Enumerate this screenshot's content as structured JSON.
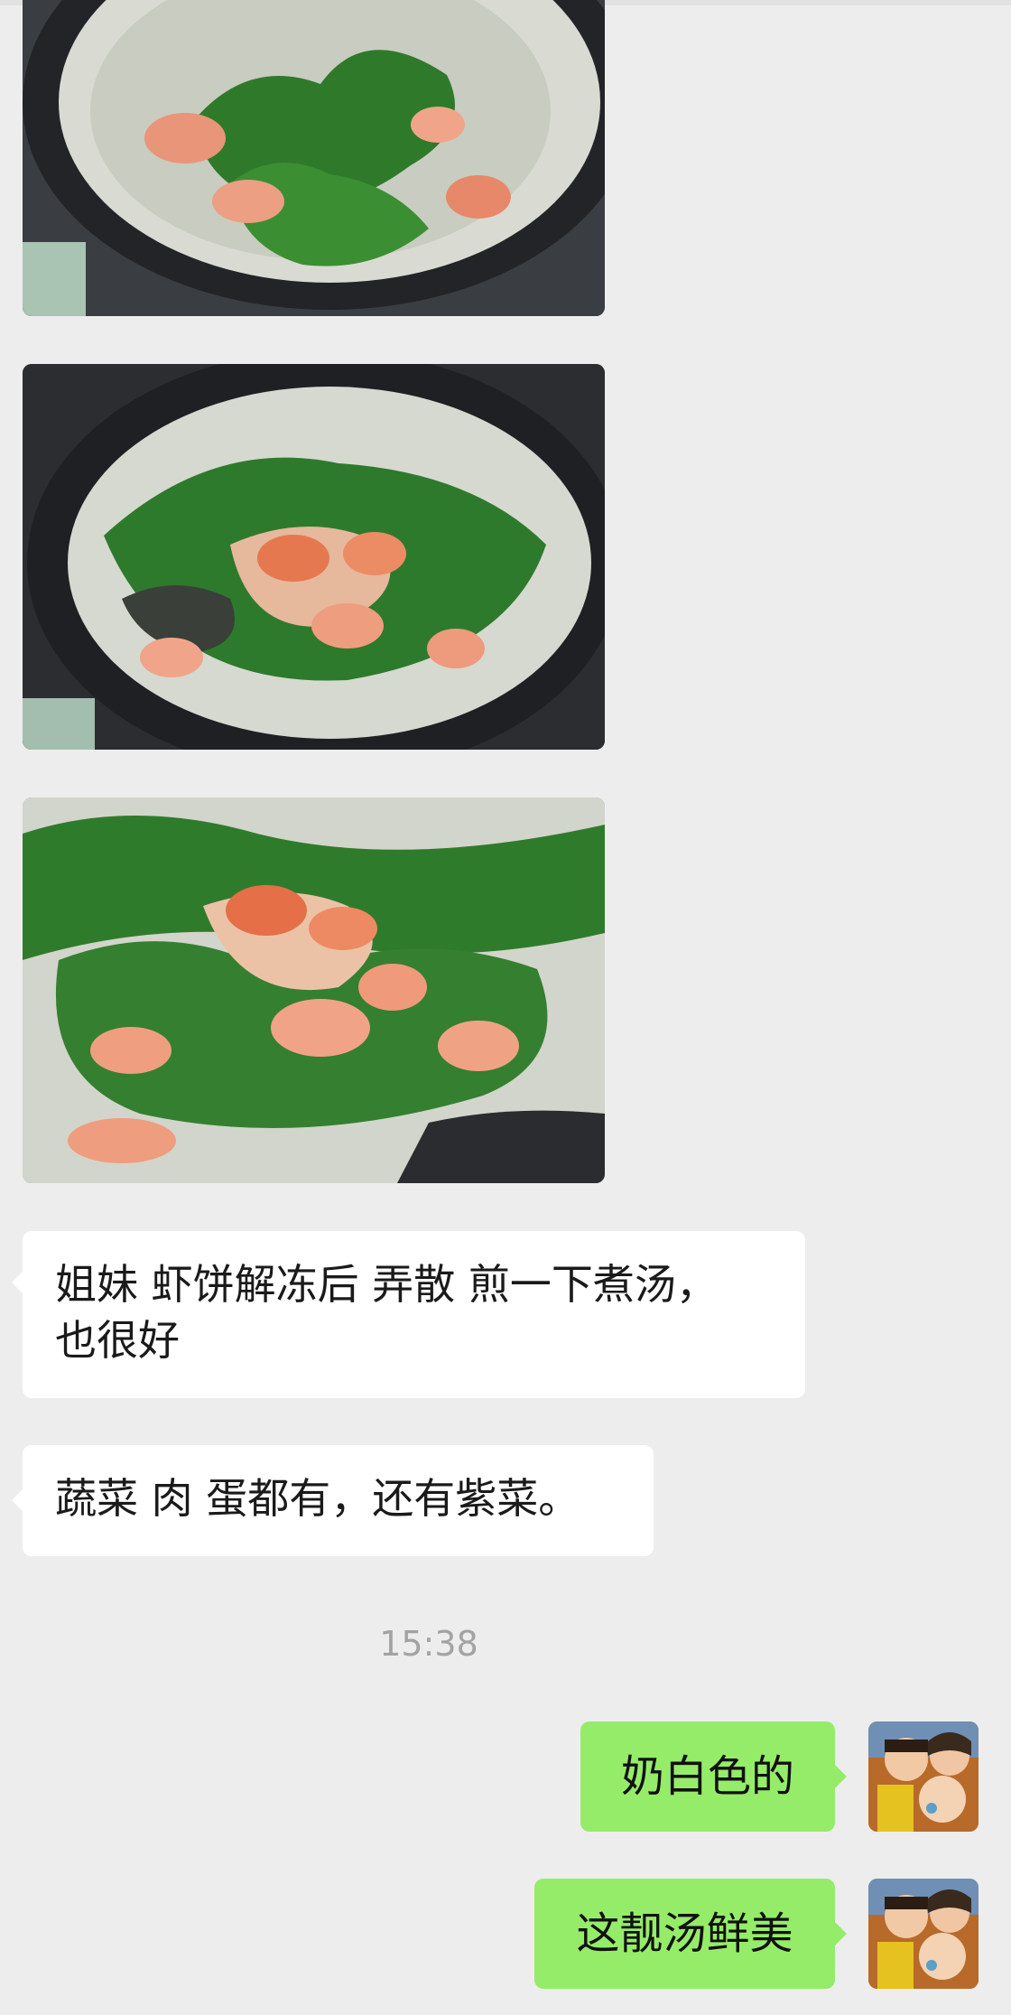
{
  "messages": {
    "received": [
      {
        "type": "image",
        "icon": "soup-photo-1"
      },
      {
        "type": "image",
        "icon": "soup-photo-2"
      },
      {
        "type": "image",
        "icon": "soup-photo-3"
      },
      {
        "type": "text",
        "lines": [
          "姐妹 虾饼解冻后 弄散 煎一下煮汤，",
          "也很好"
        ]
      },
      {
        "type": "text",
        "lines": [
          "蔬菜 肉 蛋都有，还有紫菜。"
        ]
      }
    ],
    "timestamp": "15:38",
    "sent": [
      {
        "text": "奶白色的",
        "avatar": "family-avatar"
      },
      {
        "text": "这靓汤鲜美",
        "avatar": "family-avatar"
      }
    ]
  },
  "colors": {
    "background": "#ededed",
    "received_bubble": "#ffffff",
    "sent_bubble": "#95ec69",
    "timestamp_text": "#a3a3a3"
  }
}
